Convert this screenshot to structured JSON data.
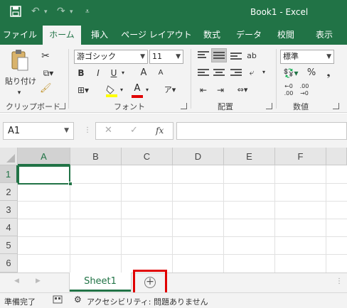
{
  "titlebar": {
    "title": "Book1  -  Excel",
    "accent": "#217346",
    "save_icon": "save-icon",
    "undo_icon": "undo-icon",
    "redo_icon": "redo-icon",
    "qat_icon": "customize-qat-icon"
  },
  "tabs": [
    "ファイル",
    "ホーム",
    "挿入",
    "ページ レイアウト",
    "数式",
    "データ",
    "校閲",
    "表示"
  ],
  "active_tab": "ホーム",
  "ribbon": {
    "clipboard": {
      "paste_label": "貼り付け",
      "group": "クリップボード"
    },
    "font": {
      "name": "游ゴシック",
      "size": "11",
      "bold": "B",
      "italic": "I",
      "underline": "U",
      "grow": "A",
      "shrink": "A",
      "font_color_letter": "A",
      "phonetic": "ア",
      "group": "フォント"
    },
    "alignment": {
      "group": "配置"
    },
    "number": {
      "format": "標準",
      "percent": "%",
      "group": "数値"
    }
  },
  "formula_bar": {
    "name_box": "A1",
    "fx": "fx",
    "cancel": "✕",
    "enter": "✓"
  },
  "grid": {
    "columns": [
      "A",
      "B",
      "C",
      "D",
      "E",
      "F"
    ],
    "rows": [
      "1",
      "2",
      "3",
      "4",
      "5",
      "6"
    ],
    "active_cell": "A1"
  },
  "sheets": {
    "tabs": [
      "Sheet1"
    ],
    "add_label": "+"
  },
  "status": {
    "ready": "準備完了",
    "accessibility": "アクセシビリティ: 問題ありません"
  }
}
